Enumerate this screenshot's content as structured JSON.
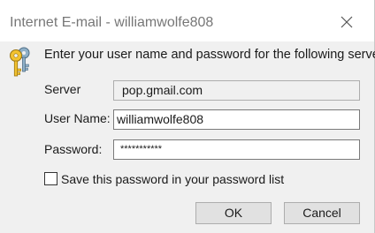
{
  "window": {
    "title": "Internet E-mail - williamwolfe808"
  },
  "prompt": {
    "instruction": "Enter your user name and password for the following server."
  },
  "form": {
    "server_label": "Server",
    "server_value": "pop.gmail.com",
    "username_label": "User Name:",
    "username_value": "williamwolfe808",
    "password_label": "Password:",
    "password_value": "***********",
    "save_password_label": "Save this password in your password list",
    "save_password_checked": false
  },
  "buttons": {
    "ok_label": "OK",
    "cancel_label": "Cancel"
  },
  "icons": {
    "close": "close-icon",
    "credentials": "key-icon"
  }
}
